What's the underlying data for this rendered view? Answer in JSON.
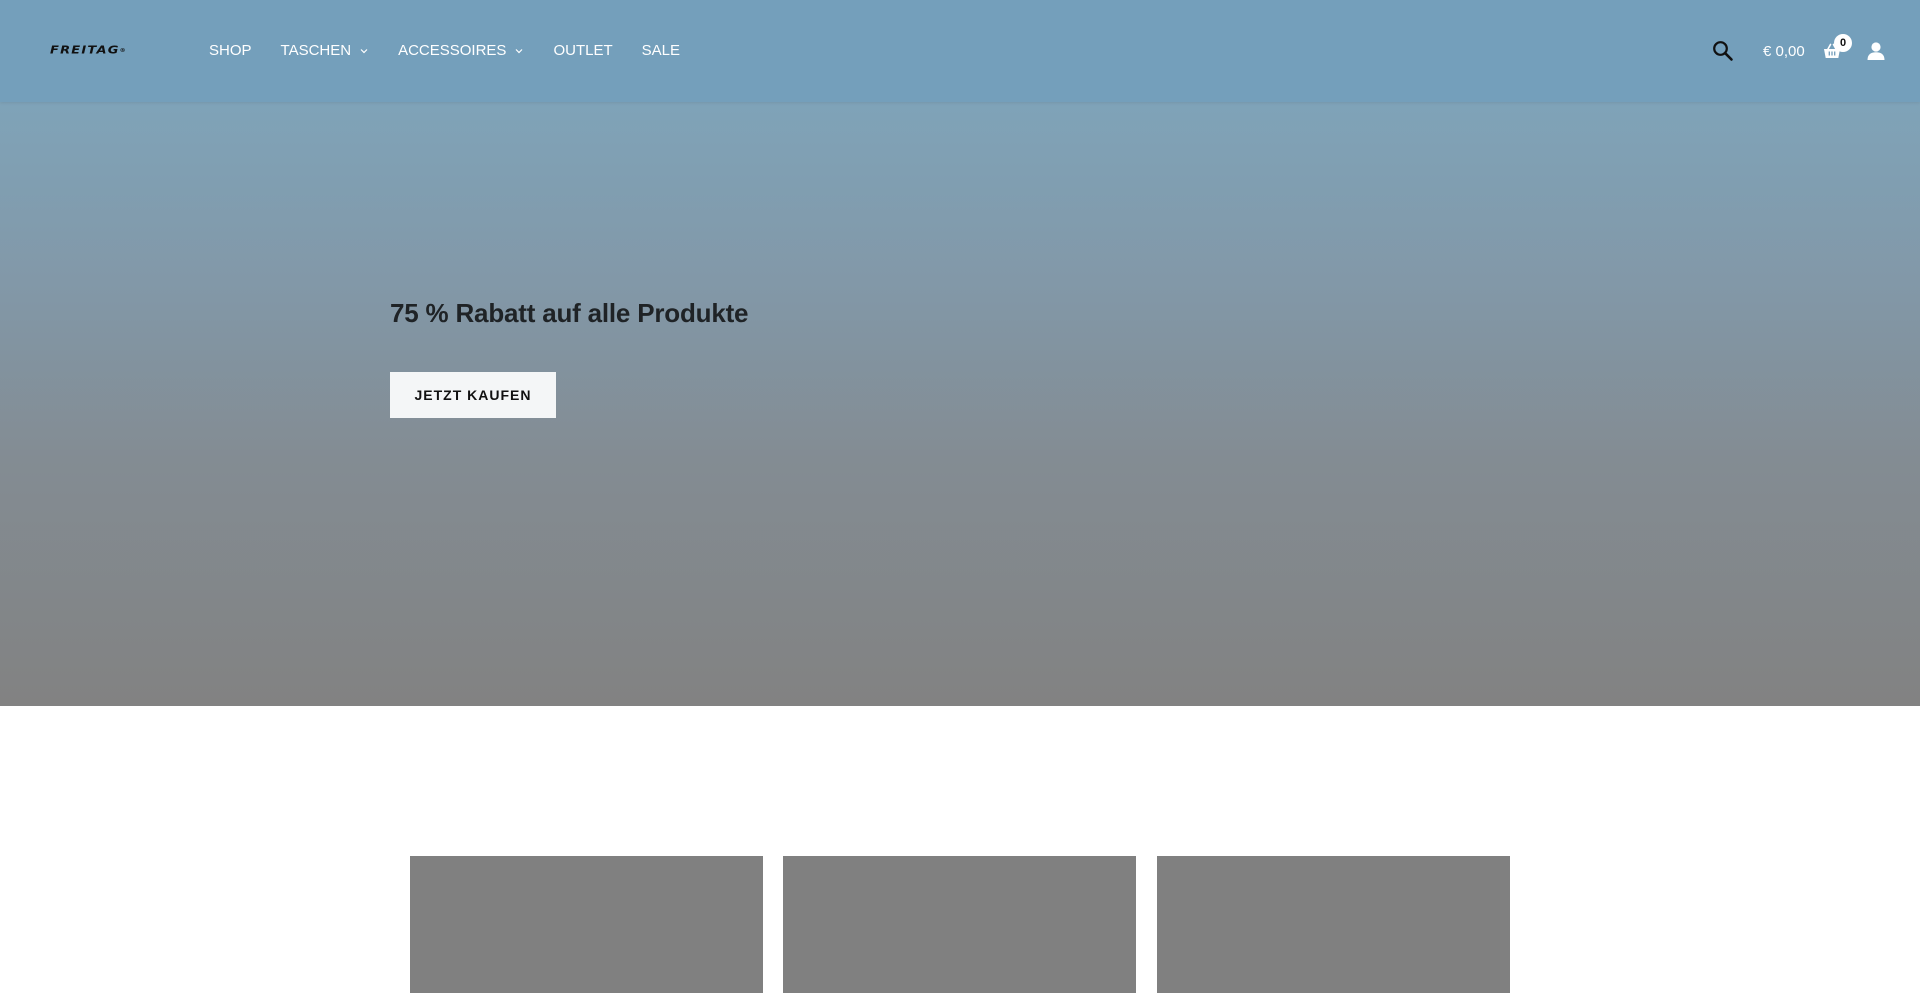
{
  "header": {
    "logo_text": "FREITAG",
    "logo_mark": "®",
    "nav": [
      {
        "label": "SHOP",
        "has_dropdown": false
      },
      {
        "label": "TASCHEN",
        "has_dropdown": true
      },
      {
        "label": "ACCESSOIRES",
        "has_dropdown": true
      },
      {
        "label": "OUTLET",
        "has_dropdown": false
      },
      {
        "label": "SALE",
        "has_dropdown": false
      }
    ],
    "search_icon": "search-icon",
    "cart_total": "€ 0,00",
    "cart_icon": "basket-icon",
    "cart_count": "0",
    "account_icon": "user-icon"
  },
  "hero": {
    "title": "75 % Rabatt auf alle Produkte",
    "cta_label": "JETZT KAUFEN"
  },
  "colors": {
    "header_bg": "#739ebb",
    "hero_top": "#7aa2bc",
    "hero_bottom": "#828282",
    "card_placeholder": "#808080",
    "cta_bg": "#f4f6f7",
    "title_text": "#1f2326"
  }
}
